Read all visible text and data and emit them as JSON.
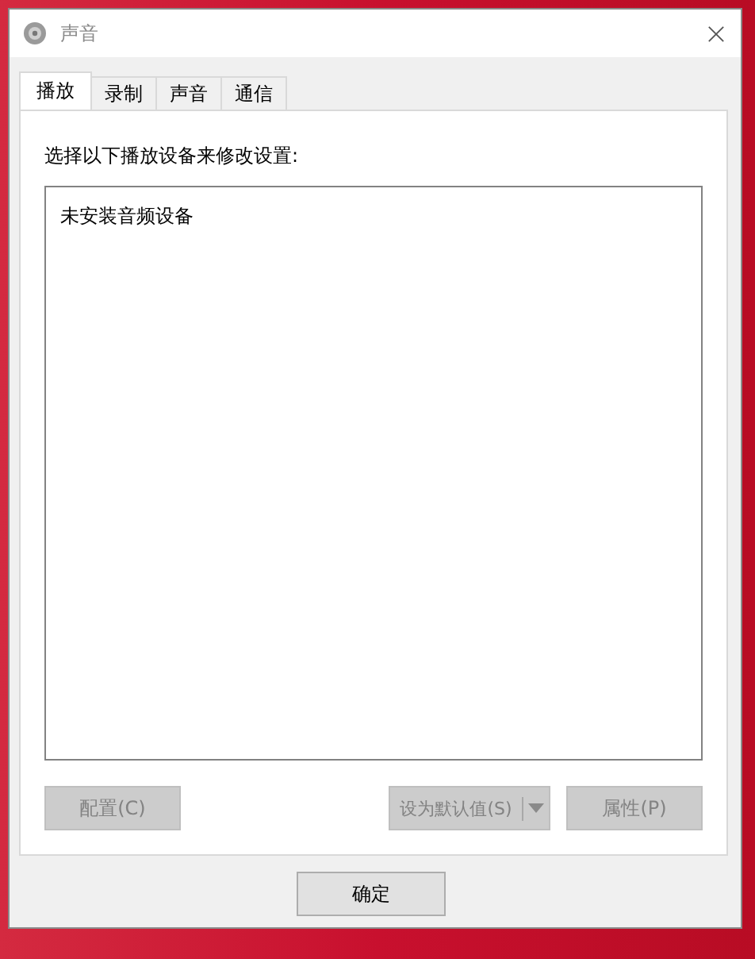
{
  "window": {
    "title": "声音"
  },
  "tabs": [
    {
      "label": "播放",
      "selected": true
    },
    {
      "label": "录制",
      "selected": false
    },
    {
      "label": "声音",
      "selected": false
    },
    {
      "label": "通信",
      "selected": false
    }
  ],
  "instruction": "选择以下播放设备来修改设置:",
  "device_list": {
    "empty_message": "未安装音频设备"
  },
  "device_buttons": [
    {
      "kind": "plain",
      "label": "配置(C)",
      "disabled": true
    },
    {
      "kind": "split",
      "label": "设为默认值(S)",
      "disabled": true
    },
    {
      "kind": "plain",
      "label": "属性(P)",
      "disabled": true
    }
  ],
  "dialog_buttons": [
    {
      "label": "确定",
      "disabled": false
    }
  ]
}
